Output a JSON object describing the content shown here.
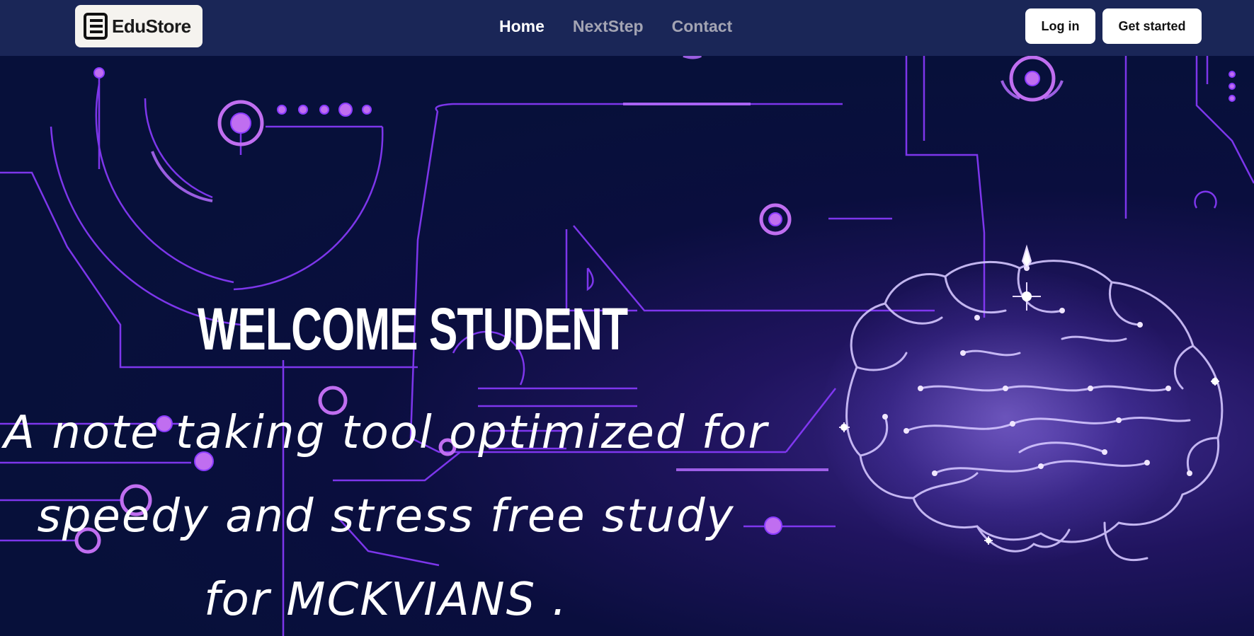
{
  "nav": {
    "logo_text": "EduStore",
    "links": [
      {
        "label": "Home",
        "active": true
      },
      {
        "label": "NextStep",
        "active": false
      },
      {
        "label": "Contact",
        "active": false
      }
    ],
    "login_label": "Log in",
    "get_started_label": "Get started"
  },
  "hero": {
    "heading": "WELCOME STUDENT",
    "tagline_lines": [
      "A note taking tool optimized for",
      "speedy and stress free study",
      "for MCKVIANS ."
    ]
  },
  "colors": {
    "navbar_bg": "#1a2657",
    "hero_bg": "#07103a",
    "circuit": "#8a3bff",
    "brain": "#c9b8ff",
    "button_bg": "#ffffff"
  },
  "icons": {
    "logo": "logo-icon",
    "brain": "brain-illustration"
  }
}
